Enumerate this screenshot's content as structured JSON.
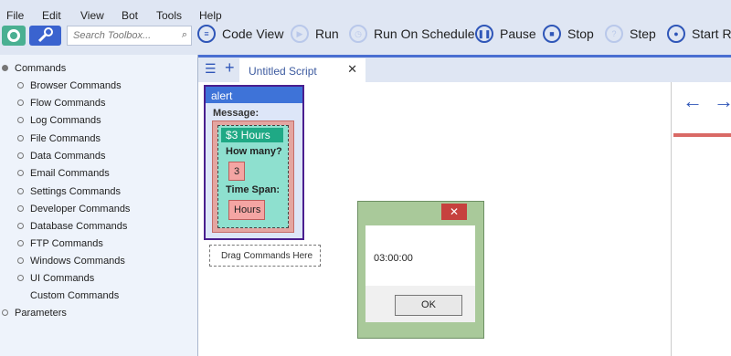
{
  "menu": [
    "File",
    "Edit",
    "View",
    "Bot",
    "Tools",
    "Help"
  ],
  "toolbar": {
    "search_placeholder": "Search Toolbox...",
    "buttons": [
      {
        "label": "Code View",
        "icon": "code-view-icon"
      },
      {
        "label": "Run",
        "icon": "run-icon"
      },
      {
        "label": "Run On Schedule",
        "icon": "schedule-icon"
      },
      {
        "label": "Pause",
        "icon": "pause-icon"
      },
      {
        "label": "Stop",
        "icon": "stop-icon"
      },
      {
        "label": "Step",
        "icon": "step-icon"
      },
      {
        "label": "Start Re",
        "icon": "record-icon"
      }
    ],
    "accent": "#2f56b8"
  },
  "sidebar": {
    "root": "Commands",
    "items": [
      "Browser Commands",
      "Flow Commands",
      "Log Commands",
      "File Commands",
      "Data Commands",
      "Email Commands",
      "Settings Commands",
      "Developer Commands",
      "Database Commands",
      "FTP Commands",
      "Windows Commands",
      "UI Commands",
      "Custom Commands"
    ],
    "parameters": "Parameters"
  },
  "tab": {
    "title": "Untitled Script"
  },
  "canvas": {
    "alert": {
      "header": "alert",
      "message_label": "Message:"
    },
    "hours": {
      "header": "$3 Hours",
      "how_many_label": "How many?",
      "how_many_value": "3",
      "time_span_label": "Time Span:",
      "time_span_value": "Hours"
    },
    "drop_target": "Drag Commands Here"
  },
  "dialog": {
    "message": "03:00:00",
    "ok": "OK"
  }
}
